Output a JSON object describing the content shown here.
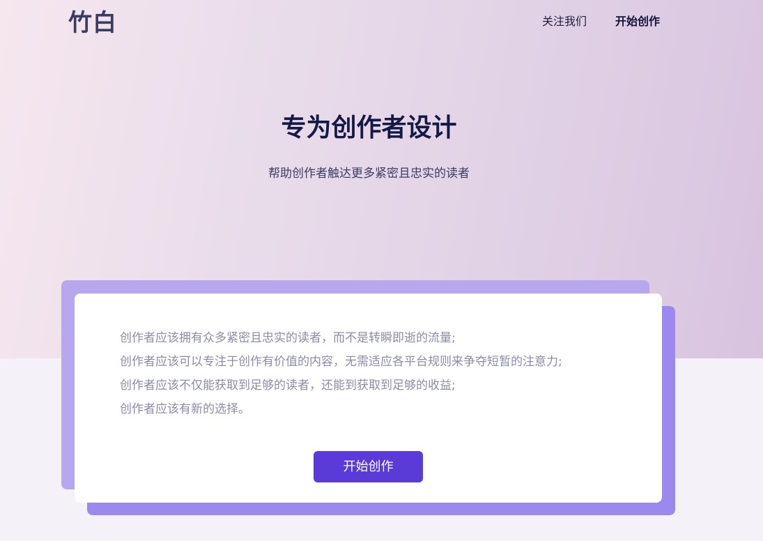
{
  "header": {
    "logo_text": "竹白",
    "nav": {
      "follow_label": "关注我们",
      "start_label": "开始创作"
    }
  },
  "hero": {
    "title": "专为创作者设计",
    "subtitle": "帮助创作者触达更多紧密且忠实的读者"
  },
  "card": {
    "lines": [
      "创作者应该拥有众多紧密且忠实的读者，而不是转瞬即逝的流量;",
      "创作者应该可以专注于创作有价值的内容，无需适应各平台规则来争夺短暂的注意力;",
      "创作者应该不仅能获取到足够的读者，还能到获取到足够的收益;",
      "创作者应该有新的选择。"
    ],
    "cta_label": "开始创作"
  },
  "colors": {
    "accent": "#5a3bd8",
    "title": "#141946",
    "body_text": "#8b8ca6",
    "deco_light": "#b7a8ed",
    "deco_dark": "#9c89ef"
  }
}
